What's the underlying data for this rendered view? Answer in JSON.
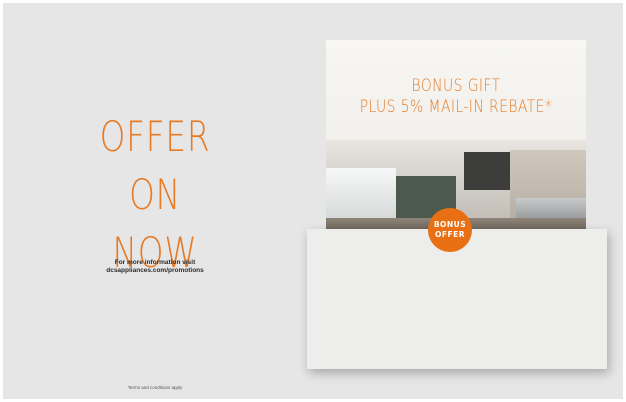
{
  "left": {
    "offer_line1": "OFFER",
    "offer_line2": "ON NOW",
    "info_line1": "For more information visit",
    "info_line2": "dcsappliances.com/promotions",
    "terms": "Terms and conditions apply"
  },
  "promo": {
    "title_line1": "BONUS GIFT",
    "title_line2": "PLUS 5% MAIL-IN REBATE*",
    "badge_line1": "BONUS",
    "badge_line2": "OFFER"
  },
  "colors": {
    "accent": "#e77a25",
    "badge": "#e86f13",
    "background": "#e6e6e7"
  }
}
